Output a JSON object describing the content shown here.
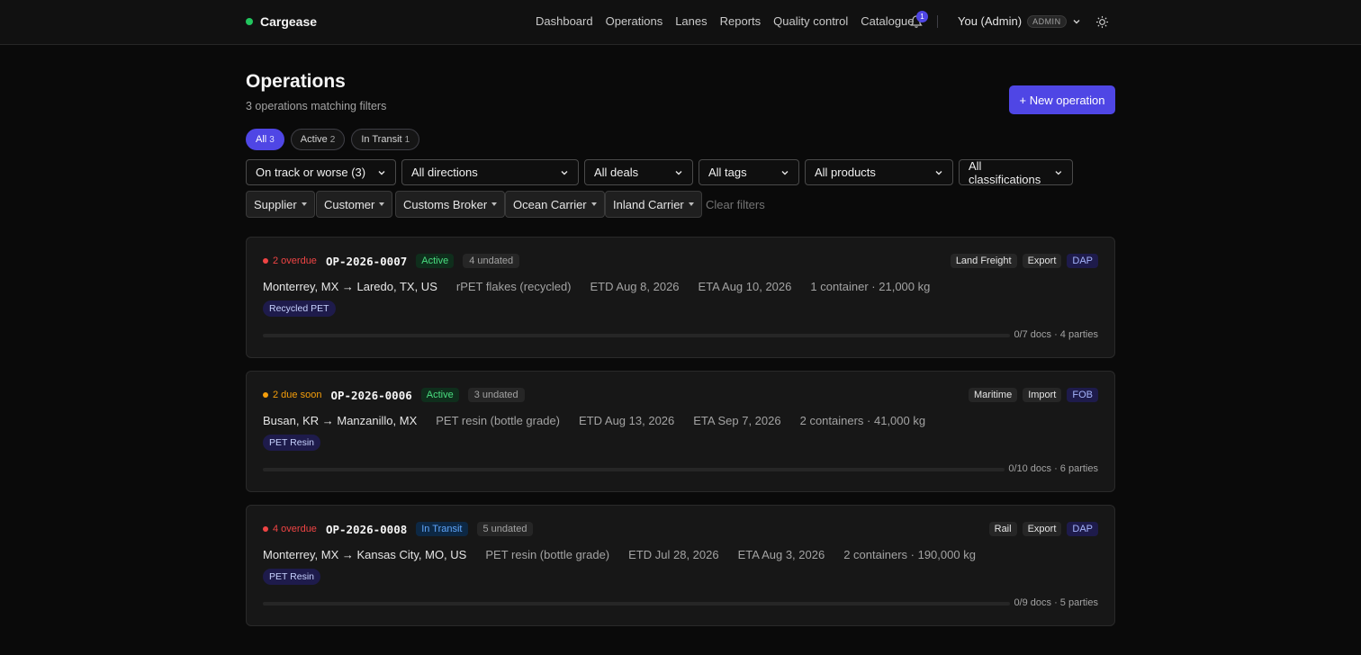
{
  "app": {
    "name": "Cargease",
    "brand_color": "#22c55e"
  },
  "nav": {
    "items": [
      "Dashboard",
      "Operations",
      "Lanes",
      "Reports",
      "Quality control",
      "Catalogue"
    ],
    "notifications": "1",
    "user": "You (Admin)",
    "role": "ADMIN"
  },
  "header": {
    "title": "Operations",
    "subtitle": "3 operations matching filters",
    "new_button": "+ New operation"
  },
  "status_chips": [
    {
      "label": "All",
      "count": "3",
      "active": true
    },
    {
      "label": "Active",
      "count": "2",
      "active": false
    },
    {
      "label": "In Transit",
      "count": "1",
      "active": false
    }
  ],
  "filters": {
    "selects": [
      "On track or worse (3)",
      "All directions",
      "All deals",
      "All tags",
      "All products",
      "All classifications"
    ],
    "roles": [
      "Supplier",
      "Customer",
      "Customs Broker",
      "Ocean Carrier",
      "Inland Carrier"
    ],
    "clear": "Clear filters"
  },
  "colors": {
    "accent": "#4f46e5",
    "overdue": "#ef4444",
    "due_soon": "#f59e0b"
  },
  "operations": [
    {
      "due": "2 overdue",
      "due_type": "overdue",
      "id": "OP-2026-0007",
      "status": "Active",
      "undated": "4 undated",
      "tags": [
        "Land Freight",
        "Export",
        "DAP"
      ],
      "route": "Monterrey, MX → Laredo, TX, US",
      "product": "rPET flakes (recycled)",
      "etd": "ETD Aug 8, 2026",
      "eta": "ETA Aug 10, 2026",
      "load": "1 container · 21,000 kg",
      "product_tag": "Recycled PET",
      "docs": "0/7 docs · 4 parties",
      "progress": 0
    },
    {
      "due": "2 due soon",
      "due_type": "soon",
      "id": "OP-2026-0006",
      "status": "Active",
      "undated": "3 undated",
      "tags": [
        "Maritime",
        "Import",
        "FOB"
      ],
      "route": "Busan, KR → Manzanillo, MX",
      "product": "PET resin (bottle grade)",
      "etd": "ETD Aug 13, 2026",
      "eta": "ETA Sep 7, 2026",
      "load": "2 containers · 41,000 kg",
      "product_tag": "PET Resin",
      "docs": "0/10 docs · 6 parties",
      "progress": 0
    },
    {
      "due": "4 overdue",
      "due_type": "overdue",
      "id": "OP-2026-0008",
      "status": "In Transit",
      "undated": "5 undated",
      "tags": [
        "Rail",
        "Export",
        "DAP"
      ],
      "route": "Monterrey, MX → Kansas City, MO, US",
      "product": "PET resin (bottle grade)",
      "etd": "ETD Jul 28, 2026",
      "eta": "ETA Aug 3, 2026",
      "load": "2 containers · 190,000 kg",
      "product_tag": "PET Resin",
      "docs": "0/9 docs · 5 parties",
      "progress": 0
    }
  ]
}
